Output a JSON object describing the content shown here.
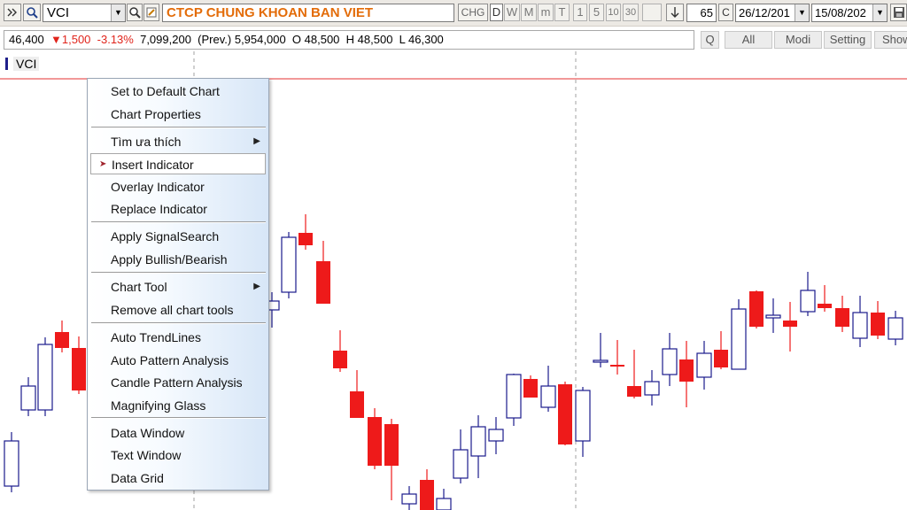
{
  "toolbar": {
    "symbol": "VCI",
    "company": "CTCP CHUNG KHOAN BAN VIET",
    "chg_label": "CHG",
    "periods": [
      "D",
      "W",
      "M",
      "m",
      "T",
      "1",
      "5",
      "10",
      "30"
    ],
    "bars_count": "65",
    "c_label": "C",
    "date_from": "26/12/201",
    "date_to": "15/08/202"
  },
  "quote": {
    "price": "46,400",
    "change_arrow": "▼",
    "change": "1,500",
    "change_pct": "-3.13%",
    "volume": "7,099,200",
    "prev_label": "(Prev.)",
    "prev": "5,954,000",
    "open": "O 48,500",
    "high": "H 48,500",
    "low": "L 46,300"
  },
  "controls": {
    "q_label": "Q",
    "all_label": "All",
    "modi_label": "Modi",
    "setting_label": "Setting",
    "show_label": "Show"
  },
  "chart": {
    "legend_symbol": "VCI",
    "colors": {
      "up": "#1a1a8c",
      "down": "#ee1a1a",
      "hline": "#e53030",
      "grid": "#9a9a9a"
    }
  },
  "menu": {
    "items": [
      {
        "label": "Set to Default Chart"
      },
      {
        "label": "Chart Properties"
      },
      {
        "label": "Tìm ưa thích",
        "submenu": true
      },
      {
        "label": "Insert Indicator",
        "highlighted": true
      },
      {
        "label": "Overlay Indicator"
      },
      {
        "label": "Replace Indicator"
      },
      {
        "label": "Apply SignalSearch"
      },
      {
        "label": "Apply Bullish/Bearish"
      },
      {
        "label": "Chart Tool",
        "submenu": true
      },
      {
        "label": "Remove all chart tools"
      },
      {
        "label": "Auto TrendLines"
      },
      {
        "label": "Auto Pattern Analysis"
      },
      {
        "label": "Candle Pattern Analysis"
      },
      {
        "label": "Magnifying Glass"
      },
      {
        "label": "Data Window"
      },
      {
        "label": "Text Window"
      },
      {
        "label": "Data Grid"
      }
    ]
  }
}
